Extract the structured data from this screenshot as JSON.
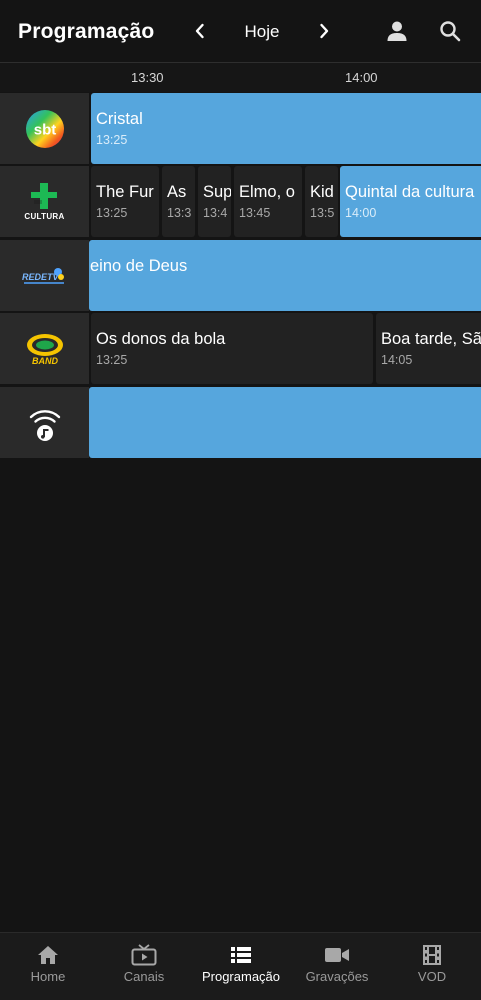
{
  "header": {
    "title": "Programação",
    "day": "Hoje"
  },
  "timeline": {
    "ticks": [
      "13:30",
      "14:00"
    ]
  },
  "channels": [
    {
      "logo_text": "sbt",
      "programs": [
        {
          "title": "Cristal",
          "time": "13:25"
        }
      ]
    },
    {
      "logo_text": "CULTURA",
      "programs": [
        {
          "title": "The Fur",
          "time": "13:25"
        },
        {
          "title": "As",
          "time": "13:3"
        },
        {
          "title": "Sup",
          "time": "13:4"
        },
        {
          "title": "Elmo, o",
          "time": "13:45"
        },
        {
          "title": "Kid",
          "time": "13:5"
        },
        {
          "title": "Quintal da cultura",
          "time": "14:00"
        }
      ]
    },
    {
      "logo_text": "REDETV",
      "programs": [
        {
          "title": "eino de Deus",
          "time": ""
        }
      ]
    },
    {
      "logo_text": "BAND",
      "programs": [
        {
          "title": "Os donos da bola",
          "time": "13:25"
        },
        {
          "title": "Boa tarde, Sã",
          "time": "14:05"
        }
      ]
    },
    {
      "logo_text": "",
      "programs": [
        {
          "title": "",
          "time": ""
        }
      ]
    }
  ],
  "bottom_nav": {
    "items": [
      {
        "label": "Home",
        "icon": "home-icon"
      },
      {
        "label": "Canais",
        "icon": "tv-icon"
      },
      {
        "label": "Programação",
        "icon": "list-icon",
        "active": true
      },
      {
        "label": "Gravações",
        "icon": "video-camera-icon"
      },
      {
        "label": "VOD",
        "icon": "film-icon"
      }
    ]
  },
  "colors": {
    "background": "#141414",
    "accent_blue": "#56a6dd",
    "program_dark": "#222222",
    "channel_cell": "#2a2a2a"
  }
}
